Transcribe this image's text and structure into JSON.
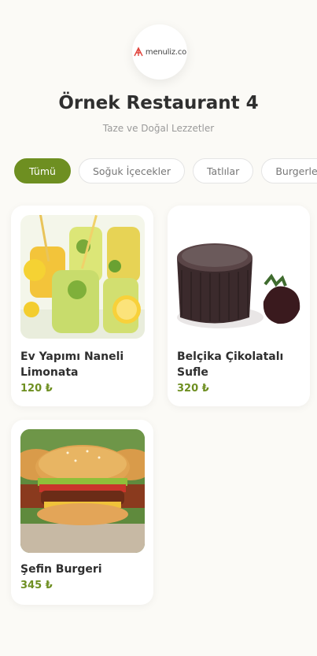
{
  "restaurant": {
    "logo_text": "menuliz.co",
    "name": "Örnek Restaurant 4",
    "tagline": "Taze ve Doğal Lezzetler"
  },
  "categories": [
    {
      "label": "Tümü",
      "active": true
    },
    {
      "label": "Soğuk İçecekler",
      "active": false
    },
    {
      "label": "Tatlılar",
      "active": false
    },
    {
      "label": "Burgerler",
      "active": false
    }
  ],
  "products": [
    {
      "name": "Ev Yapımı Naneli Limonata",
      "price": "120 ₺",
      "image": "lemonade-photo"
    },
    {
      "name": "Belçika Çikolatalı Sufle",
      "price": "320 ₺",
      "image": "chocolate-souffle-photo"
    },
    {
      "name": "Şefin Burgeri",
      "price": "345 ₺",
      "image": "burger-photo"
    }
  ],
  "colors": {
    "accent": "#6e8f21",
    "background": "#fbfaf6",
    "logo_red": "#e0463e"
  }
}
